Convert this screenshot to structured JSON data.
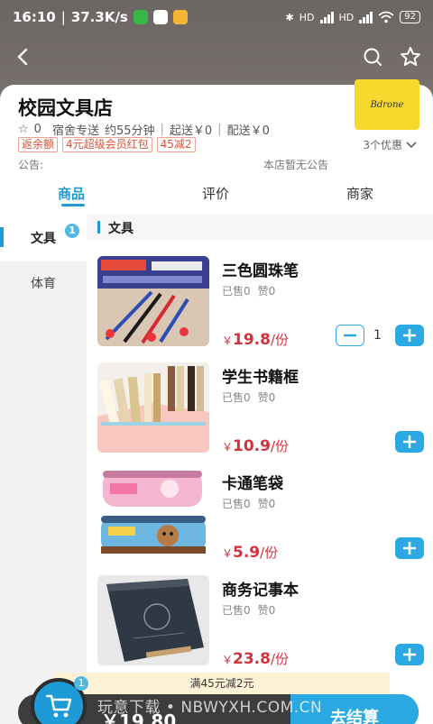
{
  "status": {
    "time": "16:10",
    "net_speed": "37.3K/s",
    "battery": "92",
    "hd1": "HD",
    "hd2": "HD"
  },
  "shop": {
    "name": "校园文具店",
    "logo_text": "Bdrone",
    "likes": "0",
    "delivery": "宿舍专送",
    "eta": "约55分钟",
    "min_order": "起送￥0",
    "delivery_fee": "配送￥0",
    "promos": [
      "返余额",
      "4元超级会员红包",
      "45减2"
    ],
    "promo_more": "3个优惠",
    "notice_label": "公告:",
    "notice_text": "本店暂无公告"
  },
  "tabs": [
    "商品",
    "评价",
    "商家"
  ],
  "categories": [
    {
      "label": "文具",
      "badge": "1"
    },
    {
      "label": "体育"
    }
  ],
  "section_title": "文具",
  "products": [
    {
      "name": "三色圆珠笔",
      "sold": "已售0",
      "likes": "赞0",
      "currency": "￥",
      "price": "19.8",
      "unit": "/份",
      "qty": "1"
    },
    {
      "name": "学生书籍框",
      "sold": "已售0",
      "likes": "赞0",
      "currency": "￥",
      "price": "10.9",
      "unit": "/份"
    },
    {
      "name": "卡通笔袋",
      "sold": "已售0",
      "likes": "赞0",
      "currency": "￥",
      "price": "5.9",
      "unit": "/份"
    },
    {
      "name": "商务记事本",
      "sold": "已售0",
      "likes": "赞0",
      "currency": "￥",
      "price": "23.8",
      "unit": "/份"
    }
  ],
  "cart": {
    "discount_tip": "满45元减2元",
    "badge": "1",
    "total": "￥19.80",
    "checkout": "去结算",
    "watermark": "玩意下载 • NBWYXH.COM.CN"
  },
  "colors": {
    "accent": "#1e9bd6",
    "price": "#d2323c",
    "promo": "#d2553b",
    "logo_bg": "#f6d92c"
  }
}
